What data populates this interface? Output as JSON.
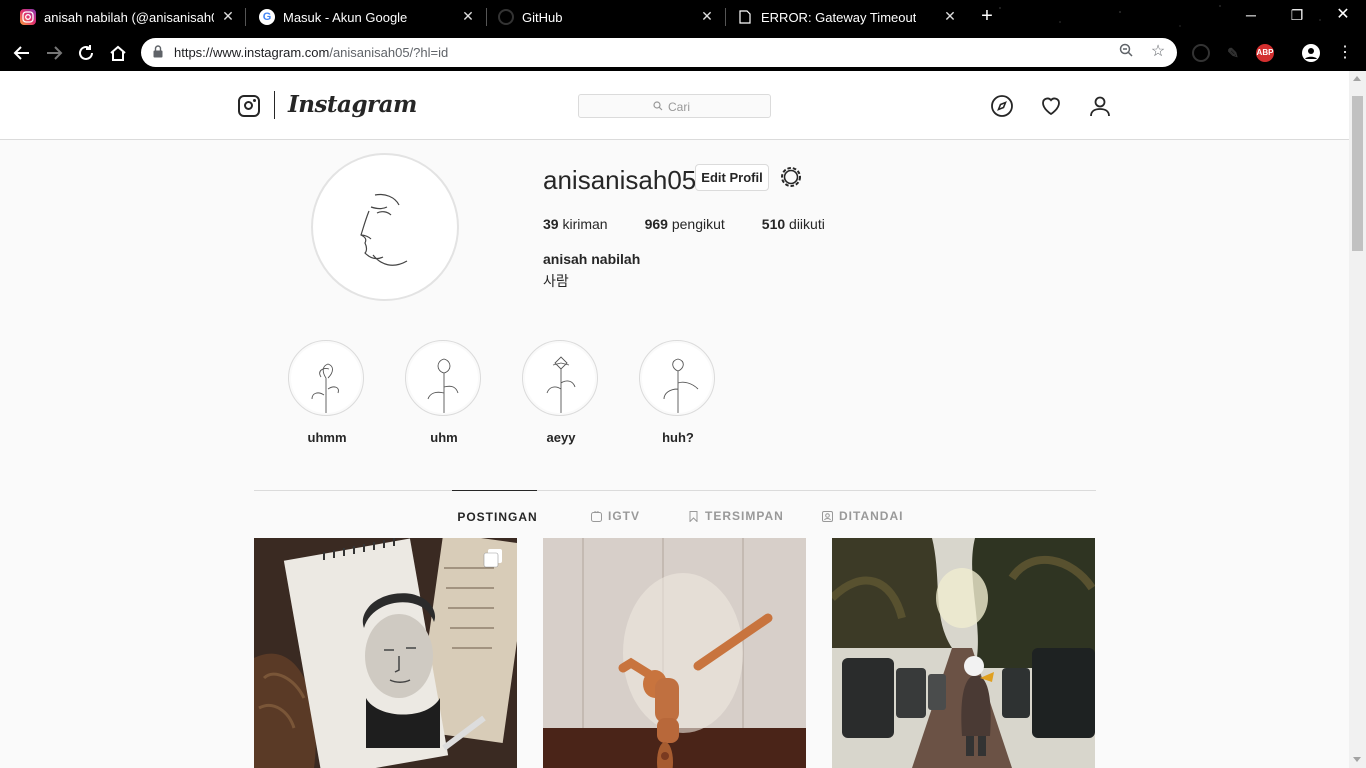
{
  "browser": {
    "tabs": [
      {
        "title": "anisah nabilah (@anisanisah05)",
        "icon": "instagram-icon",
        "active": true
      },
      {
        "title": "Masuk - Akun Google",
        "icon": "google-icon",
        "active": false
      },
      {
        "title": "GitHub",
        "icon": "github-icon",
        "active": false
      },
      {
        "title": "ERROR: Gateway Timeout",
        "icon": "document-icon",
        "active": false
      }
    ],
    "url_host": "https://www.instagram.com",
    "url_path": "/anisanisah05/?hl=id",
    "extensions": [
      "extension-icon",
      "ink-icon",
      "adblock-icon"
    ],
    "adblock_label": "ABP"
  },
  "instagram": {
    "wordmark": "Instagram",
    "search_placeholder": "Cari",
    "nav_icons": [
      "compass-icon",
      "heart-icon",
      "profile-icon"
    ]
  },
  "profile": {
    "username": "anisanisah05",
    "edit_label": "Edit Profil",
    "posts_count": "39",
    "posts_label": "kiriman",
    "followers_count": "969",
    "followers_label": "pengikut",
    "following_count": "510",
    "following_label": "diikuti",
    "full_name": "anisah nabilah",
    "bio": "사람"
  },
  "highlights": [
    {
      "label": "uhmm"
    },
    {
      "label": "uhm"
    },
    {
      "label": "aeyy"
    },
    {
      "label": "huh?"
    }
  ],
  "profile_tabs": [
    {
      "label": "POSTINGAN",
      "icon": "grid-icon",
      "active": true
    },
    {
      "label": "IGTV",
      "icon": "igtv-icon",
      "active": false
    },
    {
      "label": "TERSIMPAN",
      "icon": "bookmark-icon",
      "active": false
    },
    {
      "label": "DITANDAI",
      "icon": "tagged-icon",
      "active": false
    }
  ],
  "posts": [
    {
      "subject": "pencil portrait sketch",
      "multi": true
    },
    {
      "subject": "wooden mannequin dab",
      "multi": false
    },
    {
      "subject": "jeeps on forest road",
      "multi": false
    }
  ],
  "colors": {
    "adblock_red": "#d32f2f",
    "text": "#262626",
    "border": "#dbdbdb"
  }
}
